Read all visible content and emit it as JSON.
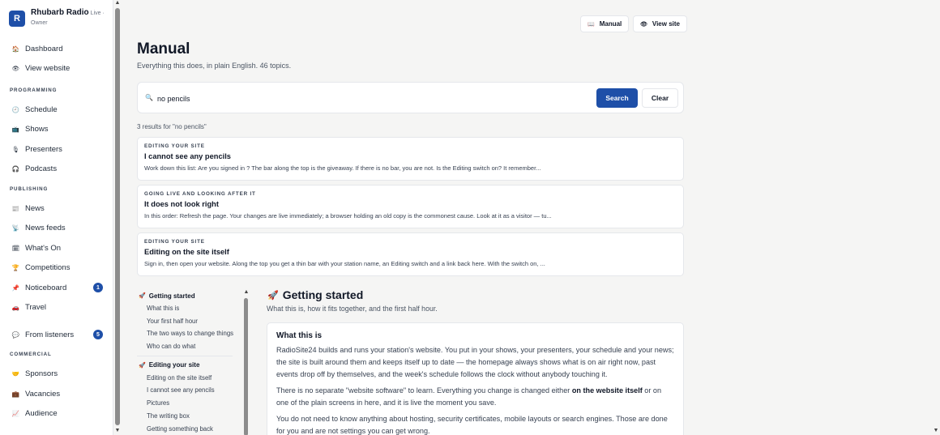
{
  "brand": {
    "logo_letter": "R",
    "name": "Rhubarb Radio",
    "live": "Live ·",
    "role": "Owner"
  },
  "sidebar": {
    "top_items": [
      {
        "label": "Dashboard",
        "icon": "🏠"
      },
      {
        "label": "View website",
        "icon": "👁"
      }
    ],
    "sections": [
      {
        "title": "PROGRAMMING",
        "items": [
          {
            "label": "Schedule",
            "icon": "🕘"
          },
          {
            "label": "Shows",
            "icon": "📺"
          },
          {
            "label": "Presenters",
            "icon": "🎙"
          },
          {
            "label": "Podcasts",
            "icon": "🎧"
          }
        ]
      },
      {
        "title": "PUBLISHING",
        "items": [
          {
            "label": "News",
            "icon": "📰"
          },
          {
            "label": "News feeds",
            "icon": "📡"
          },
          {
            "label": "What's On",
            "icon": "🗓"
          },
          {
            "label": "Competitions",
            "icon": "🏆"
          },
          {
            "label": "Noticeboard",
            "icon": "📌",
            "badge": "1"
          },
          {
            "label": "Travel",
            "icon": "🚗"
          }
        ]
      },
      {
        "title": "",
        "items": [
          {
            "label": "From listeners",
            "icon": "💬",
            "badge": "5"
          }
        ]
      },
      {
        "title": "COMMERCIAL",
        "items": [
          {
            "label": "Sponsors",
            "icon": "🤝"
          },
          {
            "label": "Vacancies",
            "icon": "💼"
          },
          {
            "label": "Audience",
            "icon": "📈"
          }
        ]
      }
    ]
  },
  "header": {
    "manual_button": "Manual",
    "manual_icon": "📖",
    "view_site_button": "View site",
    "view_site_icon": "👁",
    "title": "Manual",
    "subtitle": "Everything this does, in plain English. 46 topics."
  },
  "search": {
    "icon": "🔍",
    "value": "no pencils",
    "search_label": "Search",
    "clear_label": "Clear"
  },
  "results": {
    "count_text": "3 results for \"no pencils\"",
    "items": [
      {
        "category": "EDITING YOUR SITE",
        "title": "I cannot see any pencils",
        "snippet": "Work down this list: Are you signed in ? The bar along the top is the giveaway. If there is no bar, you are not. Is the Editing switch on? It remember..."
      },
      {
        "category": "GOING LIVE AND LOOKING AFTER IT",
        "title": "It does not look right",
        "snippet": "In this order: Refresh the page. Your changes are live immediately; a browser holding an old copy is the commonest cause. Look at it as a visitor — tu..."
      },
      {
        "category": "EDITING YOUR SITE",
        "title": "Editing on the site itself",
        "snippet": "Sign in, then open your website. Along the top you get a thin bar with your station name, an Editing switch and a link back here. With the switch on, ..."
      }
    ]
  },
  "toc": {
    "groups": [
      {
        "title": "Getting started",
        "icon": "🚀",
        "items": [
          "What this is",
          "Your first half hour",
          "The two ways to change things",
          "Who can do what"
        ]
      },
      {
        "title": "Editing your site",
        "icon": "🚀",
        "items": [
          "Editing on the site itself",
          "I cannot see any pencils",
          "Pictures",
          "The writing box",
          "Getting something back"
        ]
      }
    ]
  },
  "article": {
    "icon": "🚀",
    "title": "Getting started",
    "subtitle": "What this is, how it fits together, and the first half hour.",
    "section_title": "What this is",
    "p1": "RadioSite24 builds and runs your station's website. You put in your shows, your presenters, your schedule and your news; the site is built around them and keeps itself up to date — the homepage always shows what is on air right now, past events drop off by themselves, and the week's schedule follows the clock without anybody touching it.",
    "p2_a": "There is no separate \"website software\" to learn. Everything you change is changed either ",
    "p2_b": "on the website itself",
    "p2_c": " or on one of the plain screens in here, and it is live the moment you save.",
    "p3": "You do not need to know anything about hosting, security certificates, mobile layouts or search engines. Those are done for you and are not settings you can get wrong."
  }
}
